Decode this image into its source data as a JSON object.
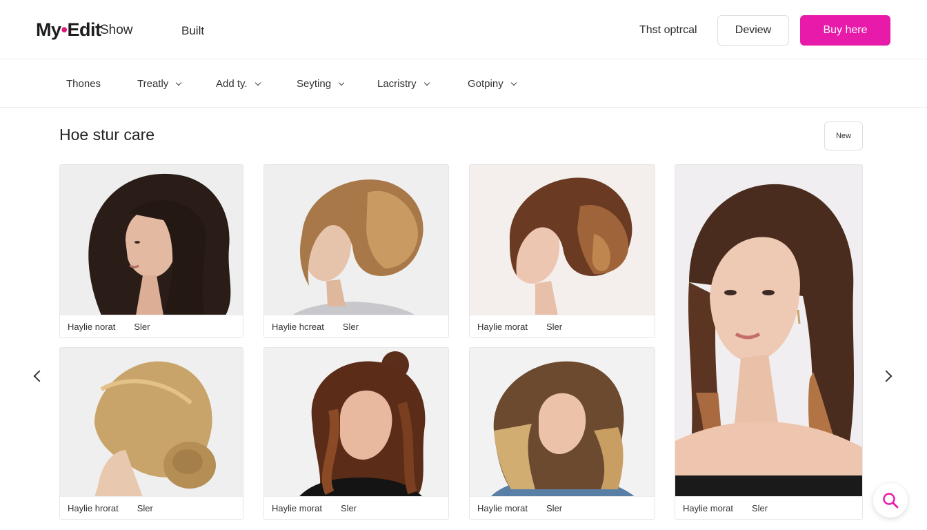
{
  "header": {
    "logo_main": "My",
    "logo_mark": "•",
    "logo_end": "Edit",
    "nav": [
      "Show",
      "Built"
    ],
    "text_link": "Thst optrcal",
    "outline_button": "Deview",
    "primary_button": "Buy here"
  },
  "filters": [
    "Thones",
    "Treatly",
    "Add ty.",
    "Seyting",
    "Lacristry",
    "Gotpiny"
  ],
  "section": {
    "title": "Hoe stur care",
    "new_button": "New"
  },
  "cards": [
    {
      "name": "Haylie norat",
      "tag": "Sler"
    },
    {
      "name": "Haylie hcreat",
      "tag": "Sler"
    },
    {
      "name": "Haylie morat",
      "tag": "Sler"
    },
    {
      "name": "Haylie morat",
      "tag": "Sler"
    },
    {
      "name": "Haylie hrorat",
      "tag": "Sler"
    },
    {
      "name": "Haylie morat",
      "tag": "Sler"
    },
    {
      "name": "Haylie morat",
      "tag": "Sler"
    }
  ],
  "colors": {
    "accent": "#e81aa9",
    "logo_dot": "#e0197a"
  },
  "icons": [
    "chevron-left-icon",
    "chevron-right-icon",
    "search-icon",
    "chevron-down-icon"
  ]
}
